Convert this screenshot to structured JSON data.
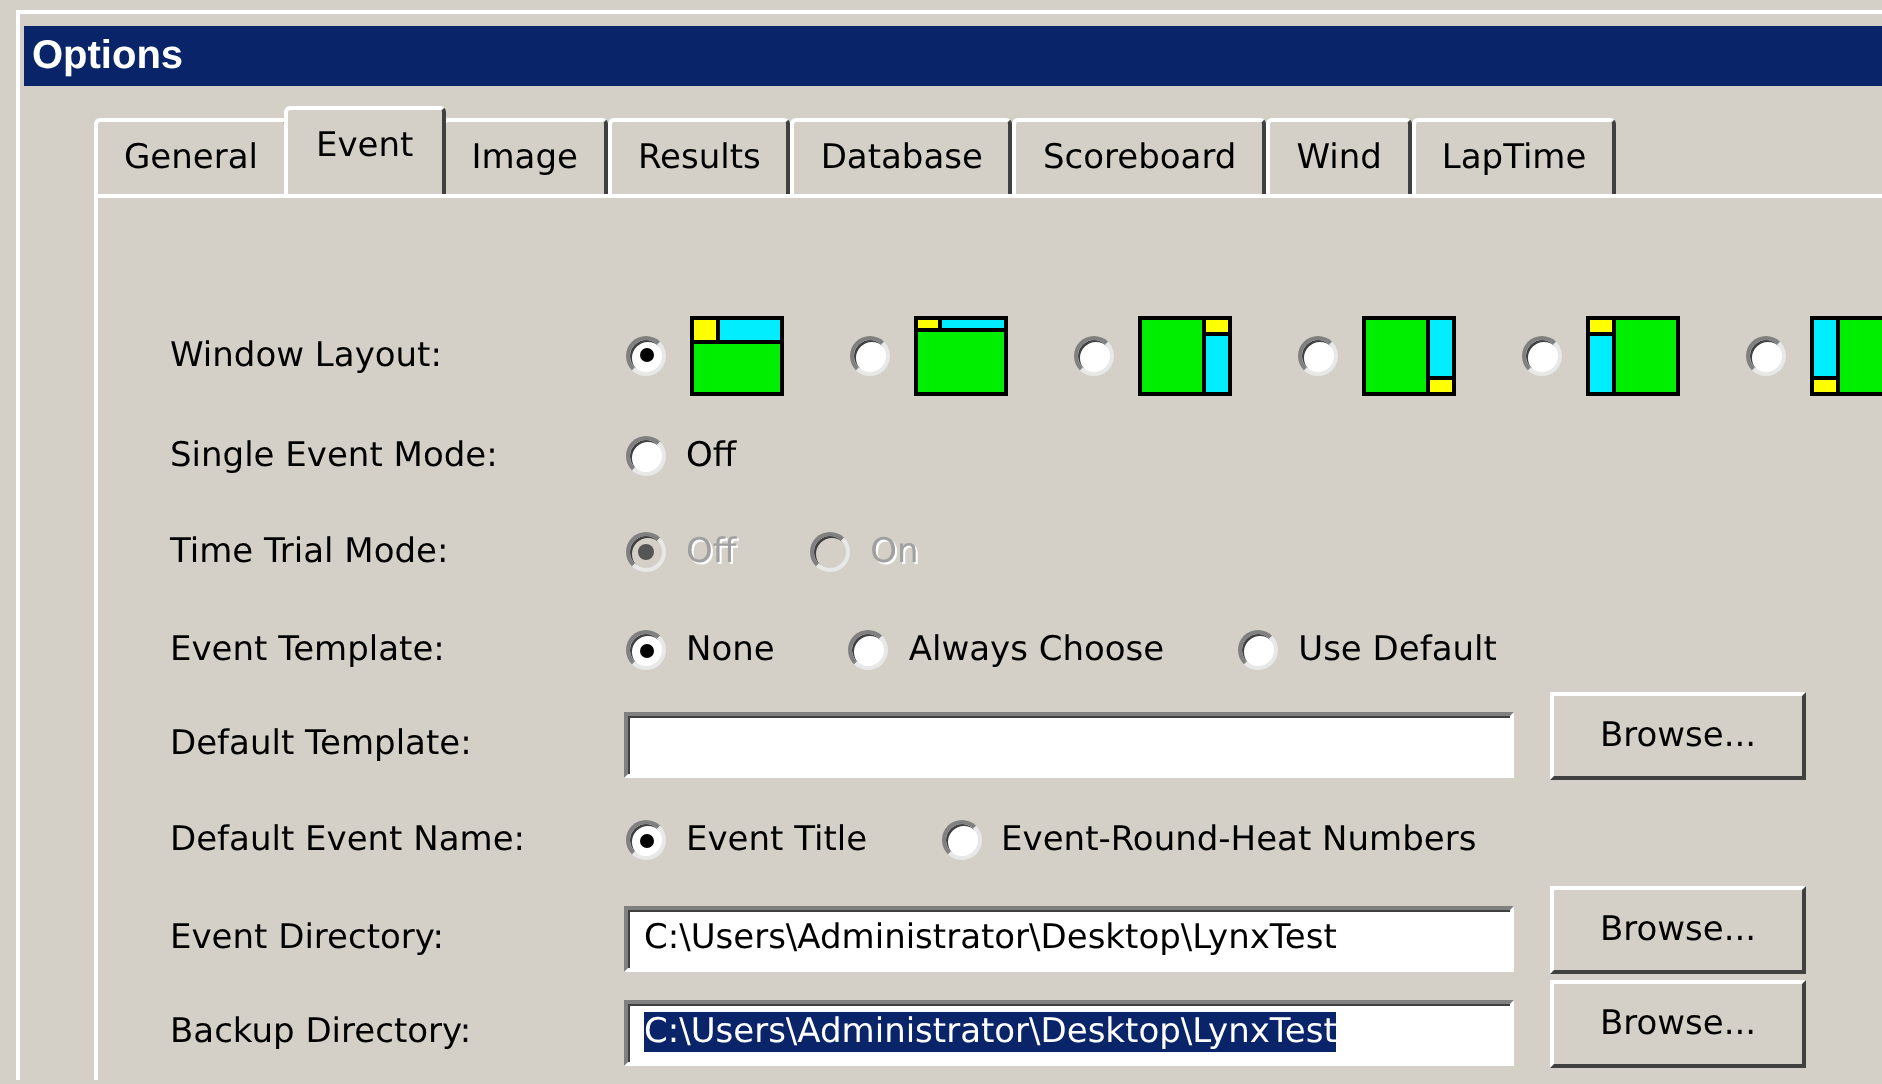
{
  "window": {
    "title": "Options"
  },
  "tabs": [
    {
      "label": "General",
      "selected": false
    },
    {
      "label": "Event",
      "selected": true
    },
    {
      "label": "Image",
      "selected": false
    },
    {
      "label": "Results",
      "selected": false
    },
    {
      "label": "Database",
      "selected": false
    },
    {
      "label": "Scoreboard",
      "selected": false
    },
    {
      "label": "Wind",
      "selected": false
    },
    {
      "label": "LapTime",
      "selected": false
    }
  ],
  "rows": [
    {
      "kind": "layouts",
      "label": "Window Layout:",
      "options": [
        {
          "kind": "top-corner",
          "selected": true
        },
        {
          "kind": "top-strip",
          "selected": false
        },
        {
          "kind": "right-top",
          "selected": false
        },
        {
          "kind": "right-bottom",
          "selected": false
        },
        {
          "kind": "left-top",
          "selected": false
        },
        {
          "kind": "left-bottom",
          "selected": false
        }
      ]
    },
    {
      "kind": "radios",
      "label": "Single Event Mode:",
      "options": [
        {
          "label": "Off",
          "selected": false,
          "disabled": false
        }
      ]
    },
    {
      "kind": "radios",
      "label": "Time Trial Mode:",
      "options": [
        {
          "label": "Off",
          "selected": true,
          "disabled": true
        },
        {
          "label": "On",
          "selected": false,
          "disabled": true
        }
      ]
    },
    {
      "kind": "radios",
      "label": "Event Template:",
      "options": [
        {
          "label": "None",
          "selected": true,
          "disabled": false
        },
        {
          "label": "Always Choose",
          "selected": false,
          "disabled": false
        },
        {
          "label": "Use Default",
          "selected": false,
          "disabled": false
        }
      ]
    },
    {
      "kind": "path",
      "label": "Default Template:",
      "button": "Browse..."
    },
    {
      "kind": "radios",
      "label": "Default Event Name:",
      "options": [
        {
          "label": "Event Title",
          "selected": true,
          "disabled": false
        },
        {
          "label": "Event-Round-Heat Numbers",
          "selected": false,
          "disabled": false
        }
      ]
    },
    {
      "kind": "path",
      "label": "Event Directory:",
      "value": "C:\\Users\\Administrator\\Desktop\\LynxTest",
      "text_selected": false,
      "button": "Browse..."
    },
    {
      "kind": "path",
      "label": "Backup Directory:",
      "value": "C:\\Users\\Administrator\\Desktop\\LynxTest",
      "text_selected": true,
      "button": "Browse..."
    }
  ]
}
